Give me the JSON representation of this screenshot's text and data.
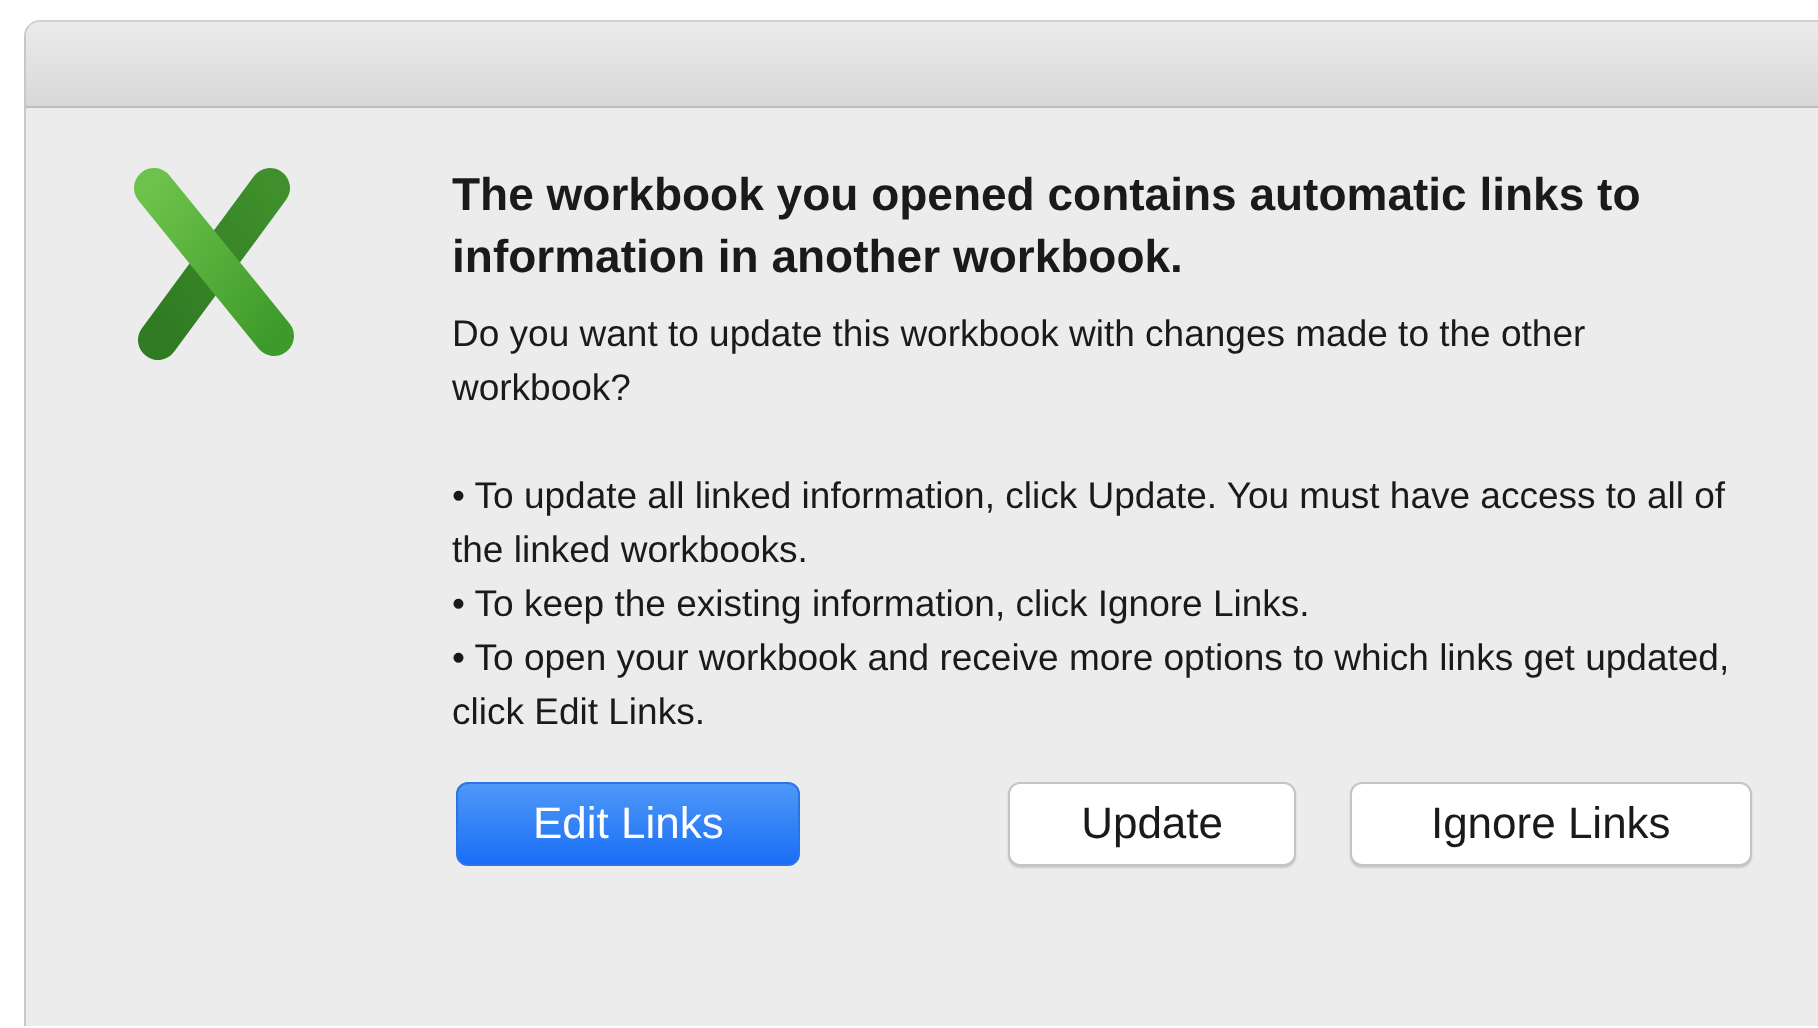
{
  "dialog": {
    "heading": "The workbook you opened contains automatic links to information in another workbook.",
    "question": "Do you want to update this workbook with changes made to the other workbook?",
    "bullets": [
      "• To update all linked information, click Update.  You must have access to all of the linked workbooks.",
      "• To keep the existing information, click Ignore Links.",
      "• To open your workbook and receive more options to which links get updated, click Edit Links."
    ],
    "buttons": [
      {
        "label": "Edit Links",
        "kind": "default"
      },
      {
        "label": "Update",
        "kind": "normal"
      },
      {
        "label": "Ignore Links",
        "kind": "normal"
      }
    ]
  }
}
